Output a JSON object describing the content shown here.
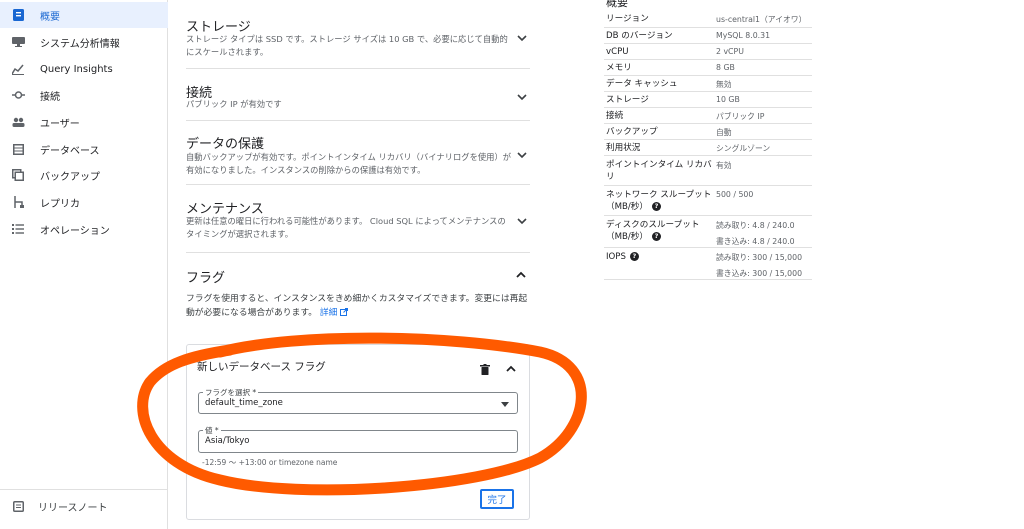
{
  "sidebar": {
    "items": [
      {
        "label": "概要",
        "icon": "overview-icon",
        "active": true
      },
      {
        "label": "システム分析情報",
        "icon": "system-insights-icon"
      },
      {
        "label": "Query Insights",
        "icon": "query-insights-icon"
      },
      {
        "label": "接続",
        "icon": "connections-icon"
      },
      {
        "label": "ユーザー",
        "icon": "users-icon"
      },
      {
        "label": "データベース",
        "icon": "databases-icon"
      },
      {
        "label": "バックアップ",
        "icon": "backups-icon"
      },
      {
        "label": "レプリカ",
        "icon": "replicas-icon"
      },
      {
        "label": "オペレーション",
        "icon": "operations-icon"
      }
    ],
    "release_notes": "リリースノート"
  },
  "main": {
    "sections": [
      {
        "title": "ストレージ",
        "desc": "ストレージ タイプは SSD です。ストレージ サイズは 10 GB で、必要に応じて自動的にスケールされます。"
      },
      {
        "title": "接続",
        "desc": "パブリック IP が有効です"
      },
      {
        "title": "データの保護",
        "desc": "自動バックアップが有効です。ポイントインタイム リカバリ（バイナリログを使用）が有効になりました。インスタンスの削除からの保護は有効です。"
      },
      {
        "title": "メンテナンス",
        "desc": "更新は任意の曜日に行われる可能性があります。 Cloud SQL によってメンテナンスのタイミングが選択されます。"
      }
    ],
    "flags": {
      "title": "フラグ",
      "desc": "フラグを使用すると、インスタンスをきめ細かくカスタマイズできます。変更には再起動が必要になる場合があります。",
      "link": "詳細",
      "card_title": "新しいデータベース フラグ",
      "select_label": "フラグを選択 *",
      "select_value": "default_time_zone",
      "value_label": "値 *",
      "value_value": "Asia/Tokyo",
      "hint": "-12:59 ～ +13:00 or timezone name",
      "done": "完了"
    }
  },
  "summary": {
    "title": "概要",
    "rows": [
      {
        "key": "リージョン",
        "value": "us-central1（アイオワ）"
      },
      {
        "key": "DB のバージョン",
        "value": "MySQL 8.0.31"
      },
      {
        "key": "vCPU",
        "value": "2 vCPU"
      },
      {
        "key": "メモリ",
        "value": "8 GB"
      },
      {
        "key": "データ キャッシュ",
        "value": "無効"
      },
      {
        "key": "ストレージ",
        "value": "10 GB"
      },
      {
        "key": "接続",
        "value": "パブリック IP"
      },
      {
        "key": "バックアップ",
        "value": "自動"
      },
      {
        "key": "利用状況",
        "value": "シングルゾーン"
      },
      {
        "key": "ポイントインタイム リカバリ",
        "value": "有効"
      },
      {
        "key": "ネットワーク スループット（MB/秒）",
        "value": "500 / 500"
      },
      {
        "key": "ディスクのスループット（MB/秒）",
        "value": "読み取り: 4.8 / 240.0",
        "value2": "書き込み: 4.8 / 240.0"
      },
      {
        "key": "IOPS",
        "value": "読み取り: 300 / 15,000",
        "value2": "書き込み: 300 / 15,000"
      }
    ]
  },
  "colors": {
    "accent": "#1a73e8",
    "annotation": "#ff5a00",
    "active_bg": "#e8f0fe"
  }
}
